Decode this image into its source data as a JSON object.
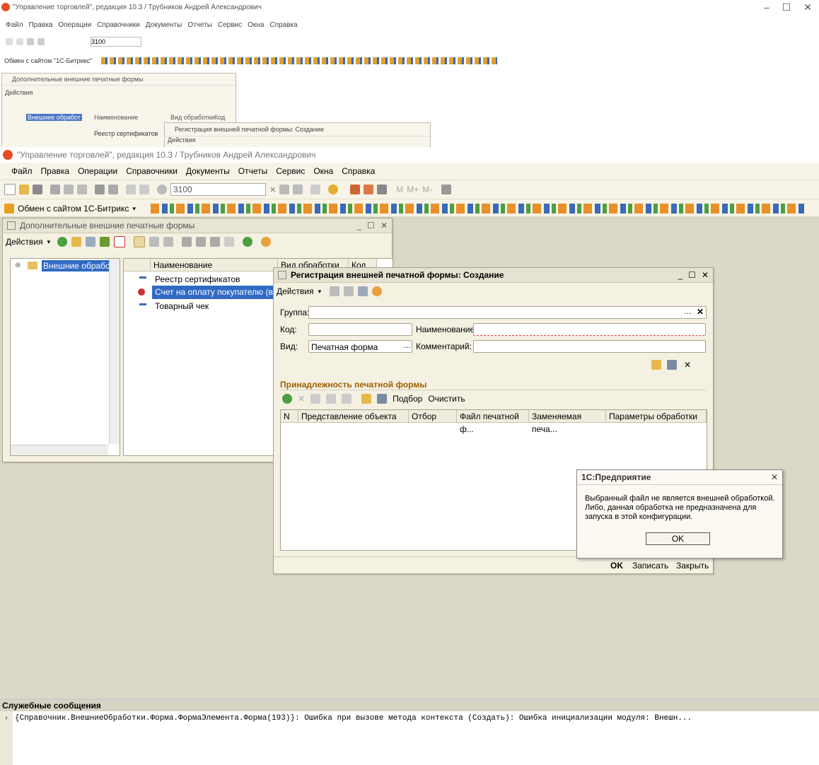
{
  "thumb": {
    "title": "\"Управление торговлей\", редакция 10.3 / Трубников Андрей Александрович",
    "menu": [
      "Файл",
      "Правка",
      "Операции",
      "Справочники",
      "Документы",
      "Отчеты",
      "Сервис",
      "Окна",
      "Справка"
    ],
    "search_value": "3100",
    "exchange_label": "Обмен с сайтом \"1С-Битрикс\"",
    "win1_title": "Дополнительные внешние печатные формы",
    "win1_actions": "Действия",
    "tree_item": "Внешние обработ",
    "col_name": "Наименование",
    "col_kind": "Вид обработки",
    "col_code": "Код",
    "row1": "Реестр сертификатов",
    "win2_title": "Регистрация внешней печатной формы: Создание",
    "win2_actions": "Действия"
  },
  "app": {
    "title": "\"Управление торговлей\", редакция 10.3 / Трубников Андрей Александрович",
    "menu": [
      "Файл",
      "Правка",
      "Операции",
      "Справочники",
      "Документы",
      "Отчеты",
      "Сервис",
      "Окна",
      "Справка"
    ],
    "toolbar": {
      "search_value": "3100",
      "m_labels": [
        "M",
        "M+",
        "M-"
      ]
    },
    "exchange_label": "Обмен с сайтом 1С-Битрикс",
    "colors": {
      "accent": "#316ac5",
      "selected_row": "#316ac5",
      "section_title": "#a06000",
      "error_underline": "#e04040"
    }
  },
  "list_window": {
    "title": "Дополнительные внешние печатные формы",
    "actions": "Действия",
    "tree_item": "Внешние обработ",
    "columns": [
      "Наименование",
      "Вид обработки",
      "Код"
    ],
    "rows": [
      "Реестр сертификатов",
      "Счет на оплату покупателю (вне...",
      "Товарный чек"
    ]
  },
  "form_window": {
    "title": "Регистрация внешней печатной формы: Создание",
    "actions": "Действия",
    "group_label": "Группа:",
    "group_value": "",
    "code_label": "Код:",
    "code_value": "",
    "name_label": "Наименование:",
    "name_value": "",
    "kind_label": "Вид:",
    "kind_value": "Печатная форма",
    "comment_label": "Комментарий:",
    "comment_value": "",
    "section_title": "Принадлежность печатной формы",
    "sub_pick": "Подбор",
    "sub_clear": "Очистить",
    "columns": [
      "N",
      "Представление объекта",
      "Отбор",
      "Файл печатной ф...",
      "Заменяемая печа...",
      "Параметры обработки"
    ],
    "ok": "OK",
    "save": "Записать",
    "close": "Закрыть"
  },
  "dialog": {
    "title": "1С:Предприятие",
    "message_line1": "Выбранный файл не является внешней обработкой.",
    "message_line2": "Либо, данная обработка не предназначена для",
    "message_line3": "запуска в этой конфигурации.",
    "ok": "OK"
  },
  "messages": {
    "title": "Служебные сообщения",
    "line": "{Справочник.ВнешниеОбработки.Форма.ФормаЭлемента.Форма(193)}: Ошибка при вызове метода контекста (Создать): Ошибка инициализации модуля: Внешн..."
  }
}
